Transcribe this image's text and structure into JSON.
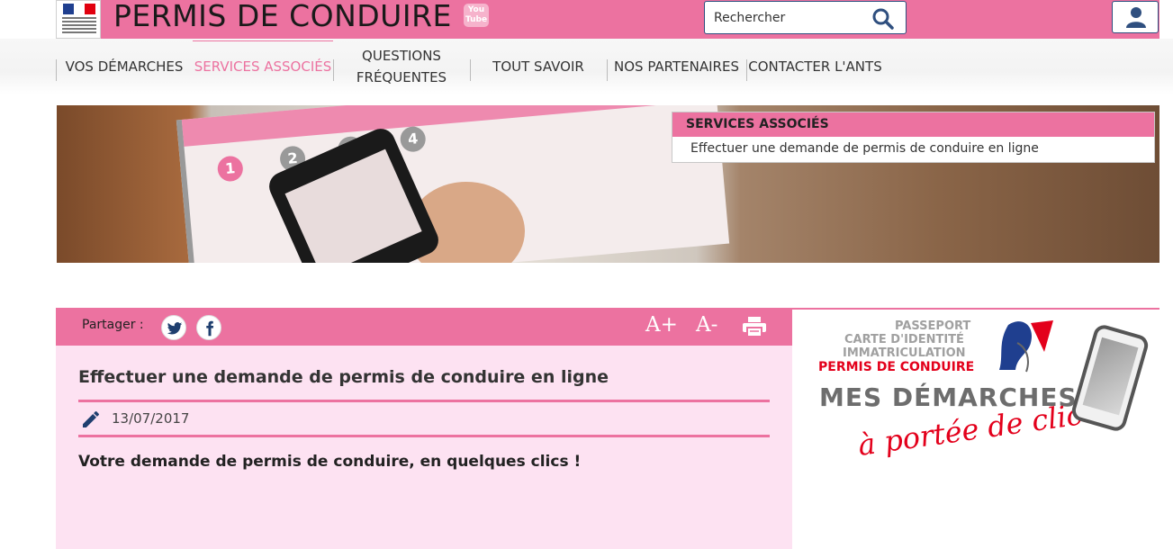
{
  "header": {
    "site_title": "PERMIS DE CONDUIRE",
    "youtube_label_1": "You",
    "youtube_label_2": "Tube",
    "search_placeholder": "Rechercher",
    "colors": {
      "brand_pink": "#ec72a0",
      "navy": "#2f4f7f",
      "light_pink": "#fde2f2"
    }
  },
  "nav": {
    "items": [
      {
        "label": "VOS DÉMARCHES",
        "active": false
      },
      {
        "label": "SERVICES ASSOCIÉS",
        "active": true
      },
      {
        "label_line1": "QUESTIONS",
        "label_line2": "FRÉQUENTES",
        "active": false
      },
      {
        "label": "TOUT SAVOIR",
        "active": false
      },
      {
        "label": "NOS PARTENAIRES",
        "active": false
      },
      {
        "label": "CONTACTER L'ANTS",
        "active": false
      }
    ]
  },
  "services_panel": {
    "heading": "SERVICES ASSOCIÉS",
    "link": "Effectuer une demande de permis de conduire en ligne"
  },
  "share": {
    "label": "Partager :",
    "icons": [
      "twitter-icon",
      "facebook-icon"
    ],
    "font_increase": "A+",
    "font_decrease": "A-",
    "print": "print-icon"
  },
  "article": {
    "title": "Effectuer une demande de permis de conduire en ligne",
    "date": "13/07/2017",
    "lead": "Votre demande de permis de conduire, en quelques clics !"
  },
  "promo": {
    "line1": "PASSEPORT",
    "line2": "CARTE D'IDENTITÉ",
    "line3": "IMMATRICULATION",
    "line4": "PERMIS DE CONDUIRE",
    "line5": "MES DÉMARCHES",
    "line6": "à portée de clic !"
  }
}
